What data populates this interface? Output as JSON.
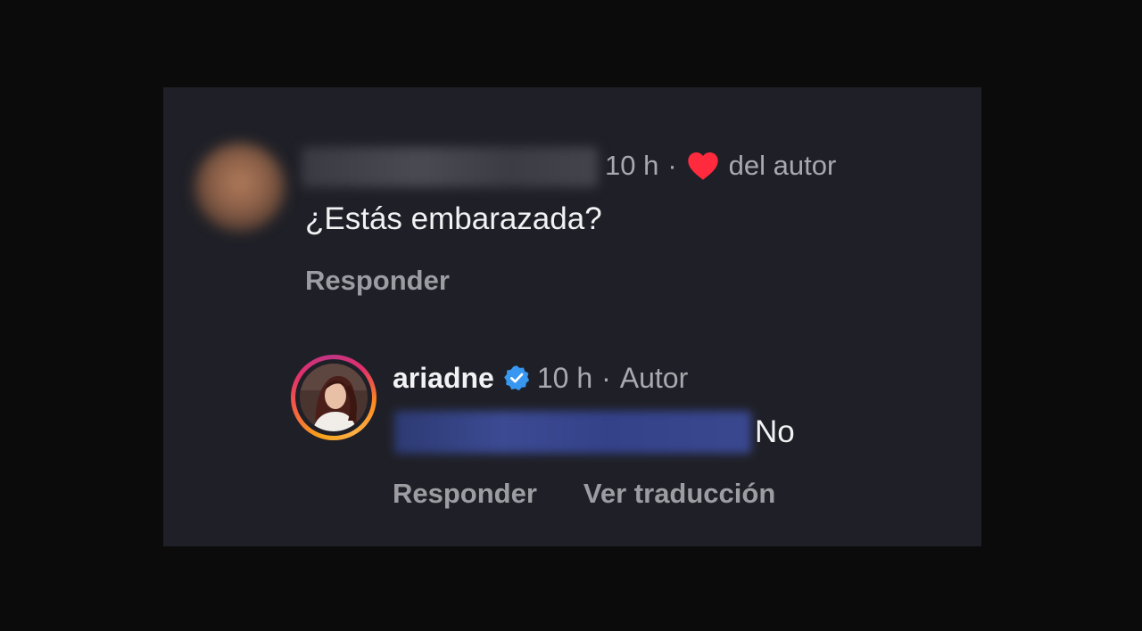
{
  "colors": {
    "page_background": "#0b0b0c",
    "panel_background": "#1f2027",
    "primary_text": "#f2f2f4",
    "secondary_text": "#a8a8ae",
    "heart": "#ff2a3d",
    "verified_badge": "#3897f0"
  },
  "comment": {
    "avatar": "blurred-avatar",
    "username": "",
    "time": "10 h",
    "separator": "·",
    "liked_icon": "heart-icon",
    "liked_by_author_label": "del autor",
    "text": "¿Estás embarazada?",
    "reply_label": "Responder"
  },
  "reply": {
    "avatar": "profile-photo",
    "username": "ariadne",
    "verified_icon": "verified-badge-icon",
    "time": "10 h",
    "separator": "·",
    "author_label": "Autor",
    "mention": "",
    "text": "No",
    "reply_label": "Responder",
    "translate_label": "Ver traducción"
  }
}
